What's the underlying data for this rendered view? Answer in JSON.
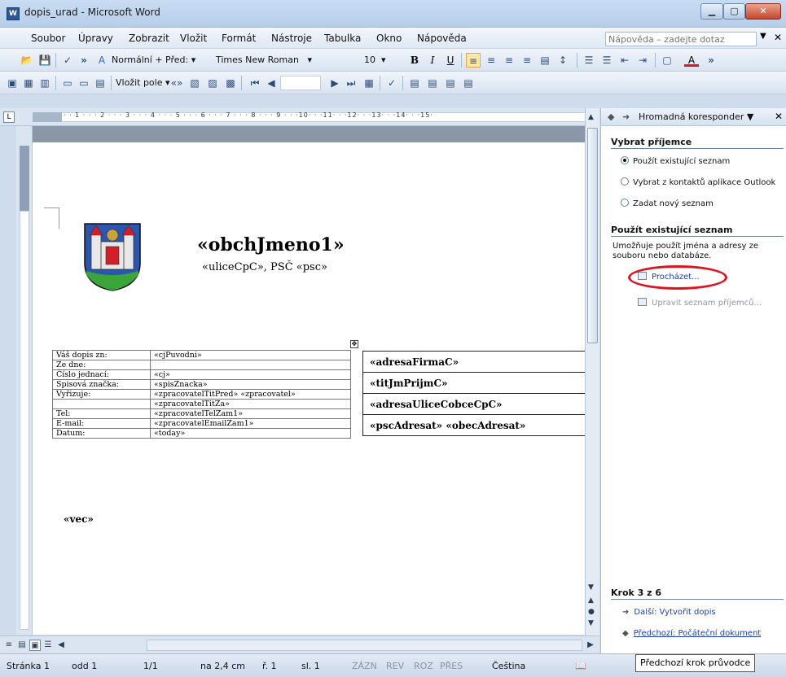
{
  "window": {
    "title": "dopis_urad - Microsoft Word"
  },
  "menu": {
    "items": [
      "Soubor",
      "Úpravy",
      "Zobrazit",
      "Vložit",
      "Formát",
      "Nástroje",
      "Tabulka",
      "Okno",
      "Nápověda"
    ],
    "help_placeholder": "Nápověda – zadejte dotaz"
  },
  "toolbar": {
    "style": "Normální + Před:",
    "font": "Times New Roman",
    "size": "10",
    "insert_field": "Vložit pole"
  },
  "ruler": {
    "labels": "· · 1 · · · 2 · · · 3 · · · 4 · · · 5 · · · 6 · · · 7 · · · 8 · · · 9 · · ·10· · ·11· · ·12· · ·13· · ·14· · ·15·"
  },
  "document": {
    "business_name": "«obchJmeno1»",
    "address_line": "«uliceCpC», PSČ «psc»",
    "info_table": [
      {
        "k": "Váš dopis zn:",
        "v": "«cjPuvodni»"
      },
      {
        "k": "Ze dne:",
        "v": ""
      },
      {
        "k": "Číslo jednací:",
        "v": "«cj»"
      },
      {
        "k": "Spisová značka:",
        "v": "«spisZnacka»"
      },
      {
        "k": "Vyřizuje:",
        "v": "«zpracovatelTitPred» «zpracovatel»"
      },
      {
        "k": "",
        "v": "«zpracovatelTitZa»"
      },
      {
        "k": "Tel:",
        "v": "«zpracovatelTelZam1»"
      },
      {
        "k": "E-mail:",
        "v": "«zpracovatelEmailZam1»"
      },
      {
        "k": "Datum:",
        "v": "«today»"
      }
    ],
    "address_table": [
      "«adresaFirmaC»",
      "«titJmPrijmC»",
      "«adresaUliceCobceCpC»",
      "«pscAdresat» «obecAdresat»"
    ],
    "subject": "«vec»"
  },
  "taskpane": {
    "title": "Hromadná koresponder",
    "section1": "Vybrat příjemce",
    "options": [
      {
        "label": "Použít existující seznam",
        "selected": true
      },
      {
        "label": "Vybrat z kontaktů aplikace Outlook",
        "selected": false
      },
      {
        "label": "Zadat nový seznam",
        "selected": false
      }
    ],
    "section2": "Použít existující seznam",
    "description": "Umožňuje použít jména a adresy ze souboru nebo databáze.",
    "browse": "Procházet...",
    "edit_list": "Upravit seznam příjemců...",
    "step": "Krok 3 z 6",
    "next": "Další: Vytvořit dopis",
    "prev": "Předchozí: Počáteční dokument"
  },
  "status": {
    "page": "Stránka 1",
    "section": "odd 1",
    "pages": "1/1",
    "at": "na 2,4 cm",
    "line": "ř. 1",
    "col": "sl. 1",
    "rec": "ZÁZN",
    "rev": "REV",
    "ext": "ROZ",
    "ovr": "PŘES",
    "lang": "Čeština"
  },
  "tooltip": "Předchozí krok průvodce",
  "colors": {
    "highlight": "#e0141e",
    "link": "#1d3fb0"
  }
}
